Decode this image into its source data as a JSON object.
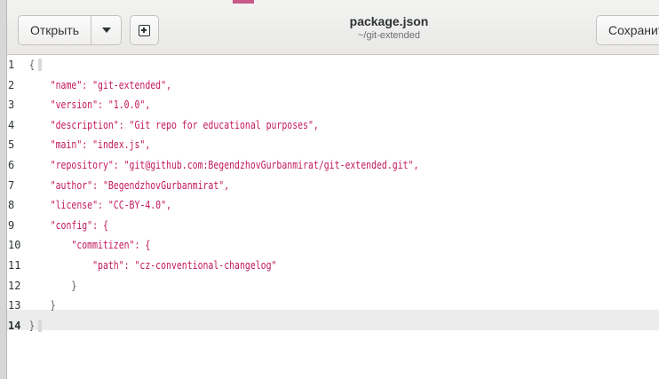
{
  "header": {
    "open_label": "Открыть",
    "menu_icon": "chevron-down-icon",
    "new_icon": "new-document-icon",
    "title": "package.json",
    "subtitle": "~/git-extended",
    "save_label": "Сохранить"
  },
  "editor": {
    "current_line": 14,
    "lines": [
      {
        "n": "1",
        "text": "{"
      },
      {
        "n": "2",
        "text": "    \"name\": \"git-extended\","
      },
      {
        "n": "3",
        "text": "    \"version\": \"1.0.0\","
      },
      {
        "n": "4",
        "text": "    \"description\": \"Git repo for educational purposes\","
      },
      {
        "n": "5",
        "text": "    \"main\": \"index.js\","
      },
      {
        "n": "6",
        "text": "    \"repository\": \"git@github.com:BegendzhovGurbanmirat/git-extended.git\","
      },
      {
        "n": "7",
        "text": "    \"author\": \"BegendzhovGurbanmirat\","
      },
      {
        "n": "8",
        "text": "    \"license\": \"CC-BY-4.0\","
      },
      {
        "n": "9",
        "text": "    \"config\": {"
      },
      {
        "n": "10",
        "text": "        \"commitizen\": {"
      },
      {
        "n": "11",
        "text": "            \"path\": \"cz-conventional-changelog\""
      },
      {
        "n": "12",
        "text": "        }"
      },
      {
        "n": "13",
        "text": "    }"
      },
      {
        "n": "14",
        "text": "}"
      }
    ]
  },
  "colors": {
    "string": "#c3185c",
    "plain": "#555a5c",
    "current_line_bg": "#ececec"
  }
}
